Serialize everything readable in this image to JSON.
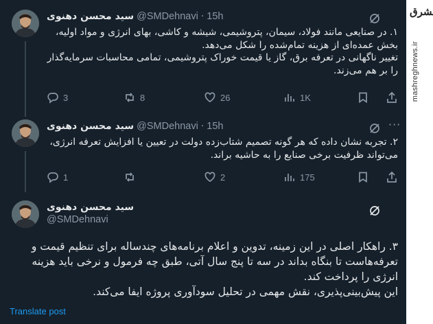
{
  "watermark": {
    "logo": "مشرق",
    "url": "mashreghnews.ir"
  },
  "tweets": [
    {
      "name": "سید محسن دهنوی",
      "handle": "@SMDehnavi",
      "sep": "·",
      "time": "15h",
      "lines": [
        "۱. در صنایعی مانند فولاد، سیمان، پتروشیمی، شیشه و کاشی، بهای انرژی و مواد اولیه،",
        "بخش عمده‌ای از هزینه تمام‌شده را شکل می‌دهد.",
        "تغییر ناگهانی در تعرفه برق، گاز یا قیمت خوراک پتروشیمی، تمامی محاسبات سرمایه‌گذار",
        "را بر هم می‌زند."
      ],
      "replies": "3",
      "reposts": "8",
      "likes": "26",
      "views": "1K"
    },
    {
      "name": "سید محسن دهنوی",
      "handle": "@SMDehnavi",
      "sep": "·",
      "time": "15h",
      "lines": [
        "۲. تجربه نشان داده که هر گونه تصمیم شتاب‌زده دولت در تعیین یا افزایش تعرفه انرژی،",
        "می‌تواند ظرفیت برخی صنایع را به حاشیه براند."
      ],
      "replies": "1",
      "reposts": "",
      "likes": "2",
      "views": "175"
    },
    {
      "name": "سید محسن دهنوی",
      "handle": "@SMDehnavi",
      "lines": [
        "۳. راهکار اصلی در این زمینه، تدوین و اعلام برنامه‌های چندساله برای تنظیم قیمت و",
        "تعرفه‌هاست تا بنگاه بداند در سه تا پنج سال آتی، طبق چه فرمول و نرخی باید هزینه",
        "انرژی را پرداخت کند.",
        "این پیش‌بینی‌پذیری، نقش مهمی در تحلیل سودآوری پروژه ایفا می‌کند."
      ],
      "translate": "Translate post"
    }
  ],
  "icons": [
    "grok-icon",
    "more-icon",
    "reply-icon",
    "repost-icon",
    "like-icon",
    "views-icon"
  ],
  "colors": {
    "background": "#15202b",
    "text": "#e7e9ea",
    "muted": "#8b98a5",
    "link": "#1d9bf0",
    "thread_line": "#38444d"
  }
}
